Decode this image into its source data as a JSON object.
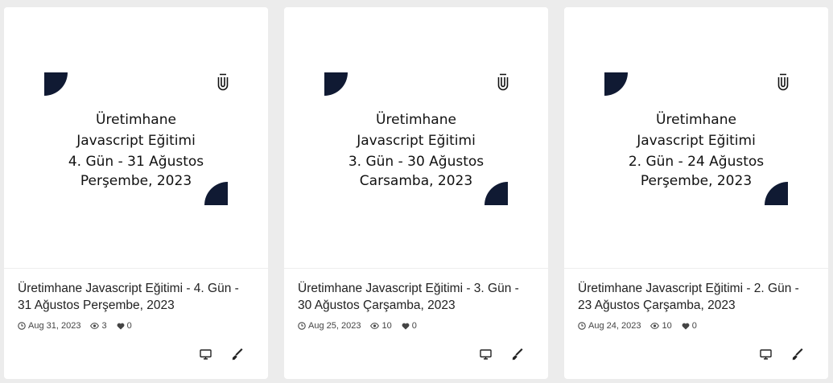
{
  "cards": [
    {
      "thumb": {
        "line1": "Üretimhane",
        "line2": "Javascript Eğitimi",
        "line3": "4. Gün - 31 Ağustos",
        "line4": "Perşembe, 2023"
      },
      "title": "Üretimhane Javascript Eğitimi - 4. Gün - 31 Ağustos Perşembe, 2023",
      "date": "Aug 31, 2023",
      "views": "3",
      "likes": "0"
    },
    {
      "thumb": {
        "line1": "Üretimhane",
        "line2": "Javascript Eğitimi",
        "line3": "3. Gün - 30 Ağustos",
        "line4": "Carsamba, 2023"
      },
      "title": "Üretimhane Javascript Eğitimi - 3. Gün - 30 Ağustos Çarşamba, 2023",
      "date": "Aug 25, 2023",
      "views": "10",
      "likes": "0"
    },
    {
      "thumb": {
        "line1": "Üretimhane",
        "line2": "Javascript Eğitimi",
        "line3": "2. Gün - 24 Ağustos",
        "line4": "Perşembe, 2023"
      },
      "title": "Üretimhane Javascript Eğitimi - 2. Gün - 23 Ağustos Çarşamba, 2023",
      "date": "Aug 24, 2023",
      "views": "10",
      "likes": "0"
    }
  ],
  "icons": {
    "date": "clock-icon",
    "views": "eye-icon",
    "likes": "heart-icon",
    "present": "monitor-icon",
    "edit": "pen-icon",
    "logo": "u-logo-icon"
  },
  "colors": {
    "accent": "#101a33",
    "background": "#ececec",
    "card": "#ffffff"
  }
}
